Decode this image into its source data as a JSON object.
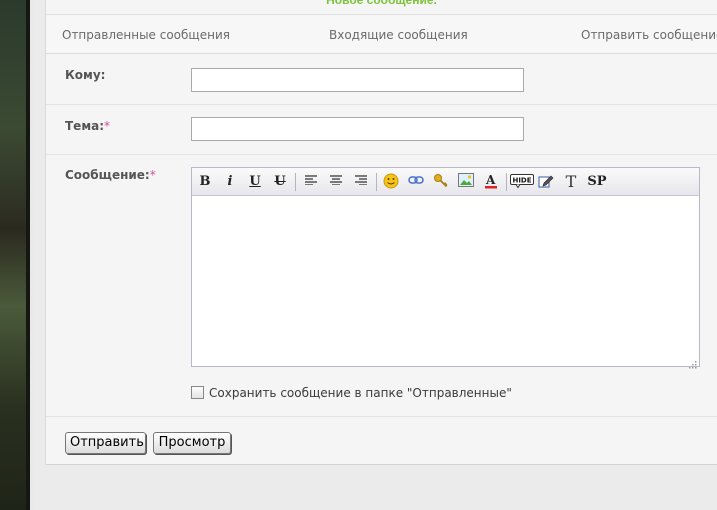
{
  "header": {
    "title": "Новое сообщение."
  },
  "tabs": [
    {
      "label": "Отправленные сообщения"
    },
    {
      "label": "Входящие сообщения"
    },
    {
      "label": "Отправить сообщение"
    }
  ],
  "form": {
    "to_label": "Кому:",
    "to_value": "",
    "subject_label": "Тема:",
    "message_label": "Сообщение:",
    "required_mark": "*",
    "message_value": "",
    "save_checkbox_label": "Сохранить сообщение в папке \"Отправленные\"",
    "save_checked": false
  },
  "toolbar": {
    "bold": "B",
    "italic": "i",
    "underline": "U",
    "strike": "U",
    "text_tool": "T",
    "spoiler": "SP",
    "hide": "HIDE",
    "font_color_letter": "A"
  },
  "buttons": {
    "send_label": "Отправить",
    "preview_label": "Просмотр"
  },
  "colors": {
    "title_green": "#7cc33a",
    "required_pink": "#d94f9a"
  }
}
